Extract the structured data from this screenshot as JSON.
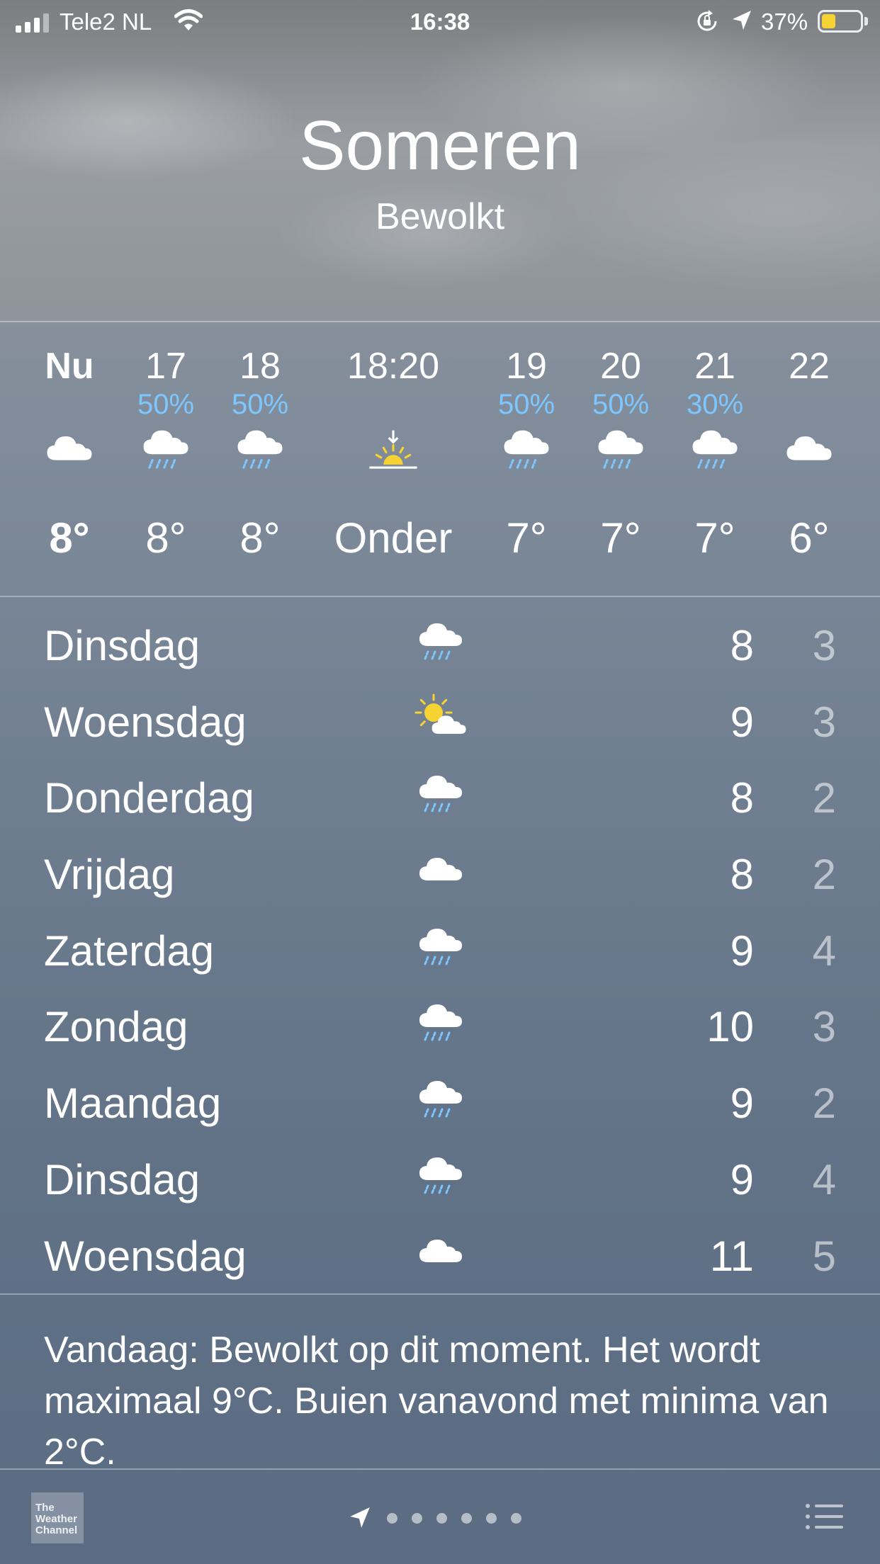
{
  "status_bar": {
    "carrier": "Tele2 NL",
    "time": "16:38",
    "battery_percent": "37%",
    "battery_level": 0.37,
    "icons": [
      "cellular-signal-icon",
      "wifi-icon",
      "orientation-lock-icon",
      "location-arrow-icon",
      "battery-icon"
    ]
  },
  "location": {
    "city": "Someren",
    "condition": "Bewolkt"
  },
  "hourly": [
    {
      "label": "Nu",
      "precip": "",
      "icon": "cloud",
      "temp": "8°"
    },
    {
      "label": "17",
      "precip": "50%",
      "icon": "cloud-rain",
      "temp": "8°"
    },
    {
      "label": "18",
      "precip": "50%",
      "icon": "cloud-rain",
      "temp": "8°"
    },
    {
      "label": "18:20",
      "precip": "",
      "icon": "sunset",
      "temp": "Onder"
    },
    {
      "label": "19",
      "precip": "50%",
      "icon": "cloud-rain",
      "temp": "7°"
    },
    {
      "label": "20",
      "precip": "50%",
      "icon": "cloud-rain",
      "temp": "7°"
    },
    {
      "label": "21",
      "precip": "30%",
      "icon": "cloud-rain",
      "temp": "7°"
    },
    {
      "label": "22",
      "precip": "",
      "icon": "cloud",
      "temp": "6°"
    }
  ],
  "daily": [
    {
      "day": "Dinsdag",
      "icon": "cloud-rain",
      "max": "8",
      "min": "3"
    },
    {
      "day": "Woensdag",
      "icon": "partly-sunny",
      "max": "9",
      "min": "3"
    },
    {
      "day": "Donderdag",
      "icon": "cloud-rain",
      "max": "8",
      "min": "2"
    },
    {
      "day": "Vrijdag",
      "icon": "cloud",
      "max": "8",
      "min": "2"
    },
    {
      "day": "Zaterdag",
      "icon": "cloud-rain",
      "max": "9",
      "min": "4"
    },
    {
      "day": "Zondag",
      "icon": "cloud-rain",
      "max": "10",
      "min": "3"
    },
    {
      "day": "Maandag",
      "icon": "cloud-rain",
      "max": "9",
      "min": "2"
    },
    {
      "day": "Dinsdag",
      "icon": "cloud-rain",
      "max": "9",
      "min": "4"
    },
    {
      "day": "Woensdag",
      "icon": "cloud",
      "max": "11",
      "min": "5"
    }
  ],
  "summary": "Vandaag: Bewolkt op dit moment. Het wordt maximaal 9°C. Buien vanavond met minima van 2°C.",
  "bottom_bar": {
    "logo_lines": [
      "The",
      "Weather",
      "Channel"
    ],
    "page_dots": 6,
    "icons": [
      "weather-channel-logo",
      "current-location-icon",
      "page-dot-icon",
      "list-icon"
    ]
  },
  "colors": {
    "precip": "#7cc7ff",
    "rain_drops": "#7cc7ff",
    "sun": "#f7d233",
    "battery": "#f7d233"
  }
}
